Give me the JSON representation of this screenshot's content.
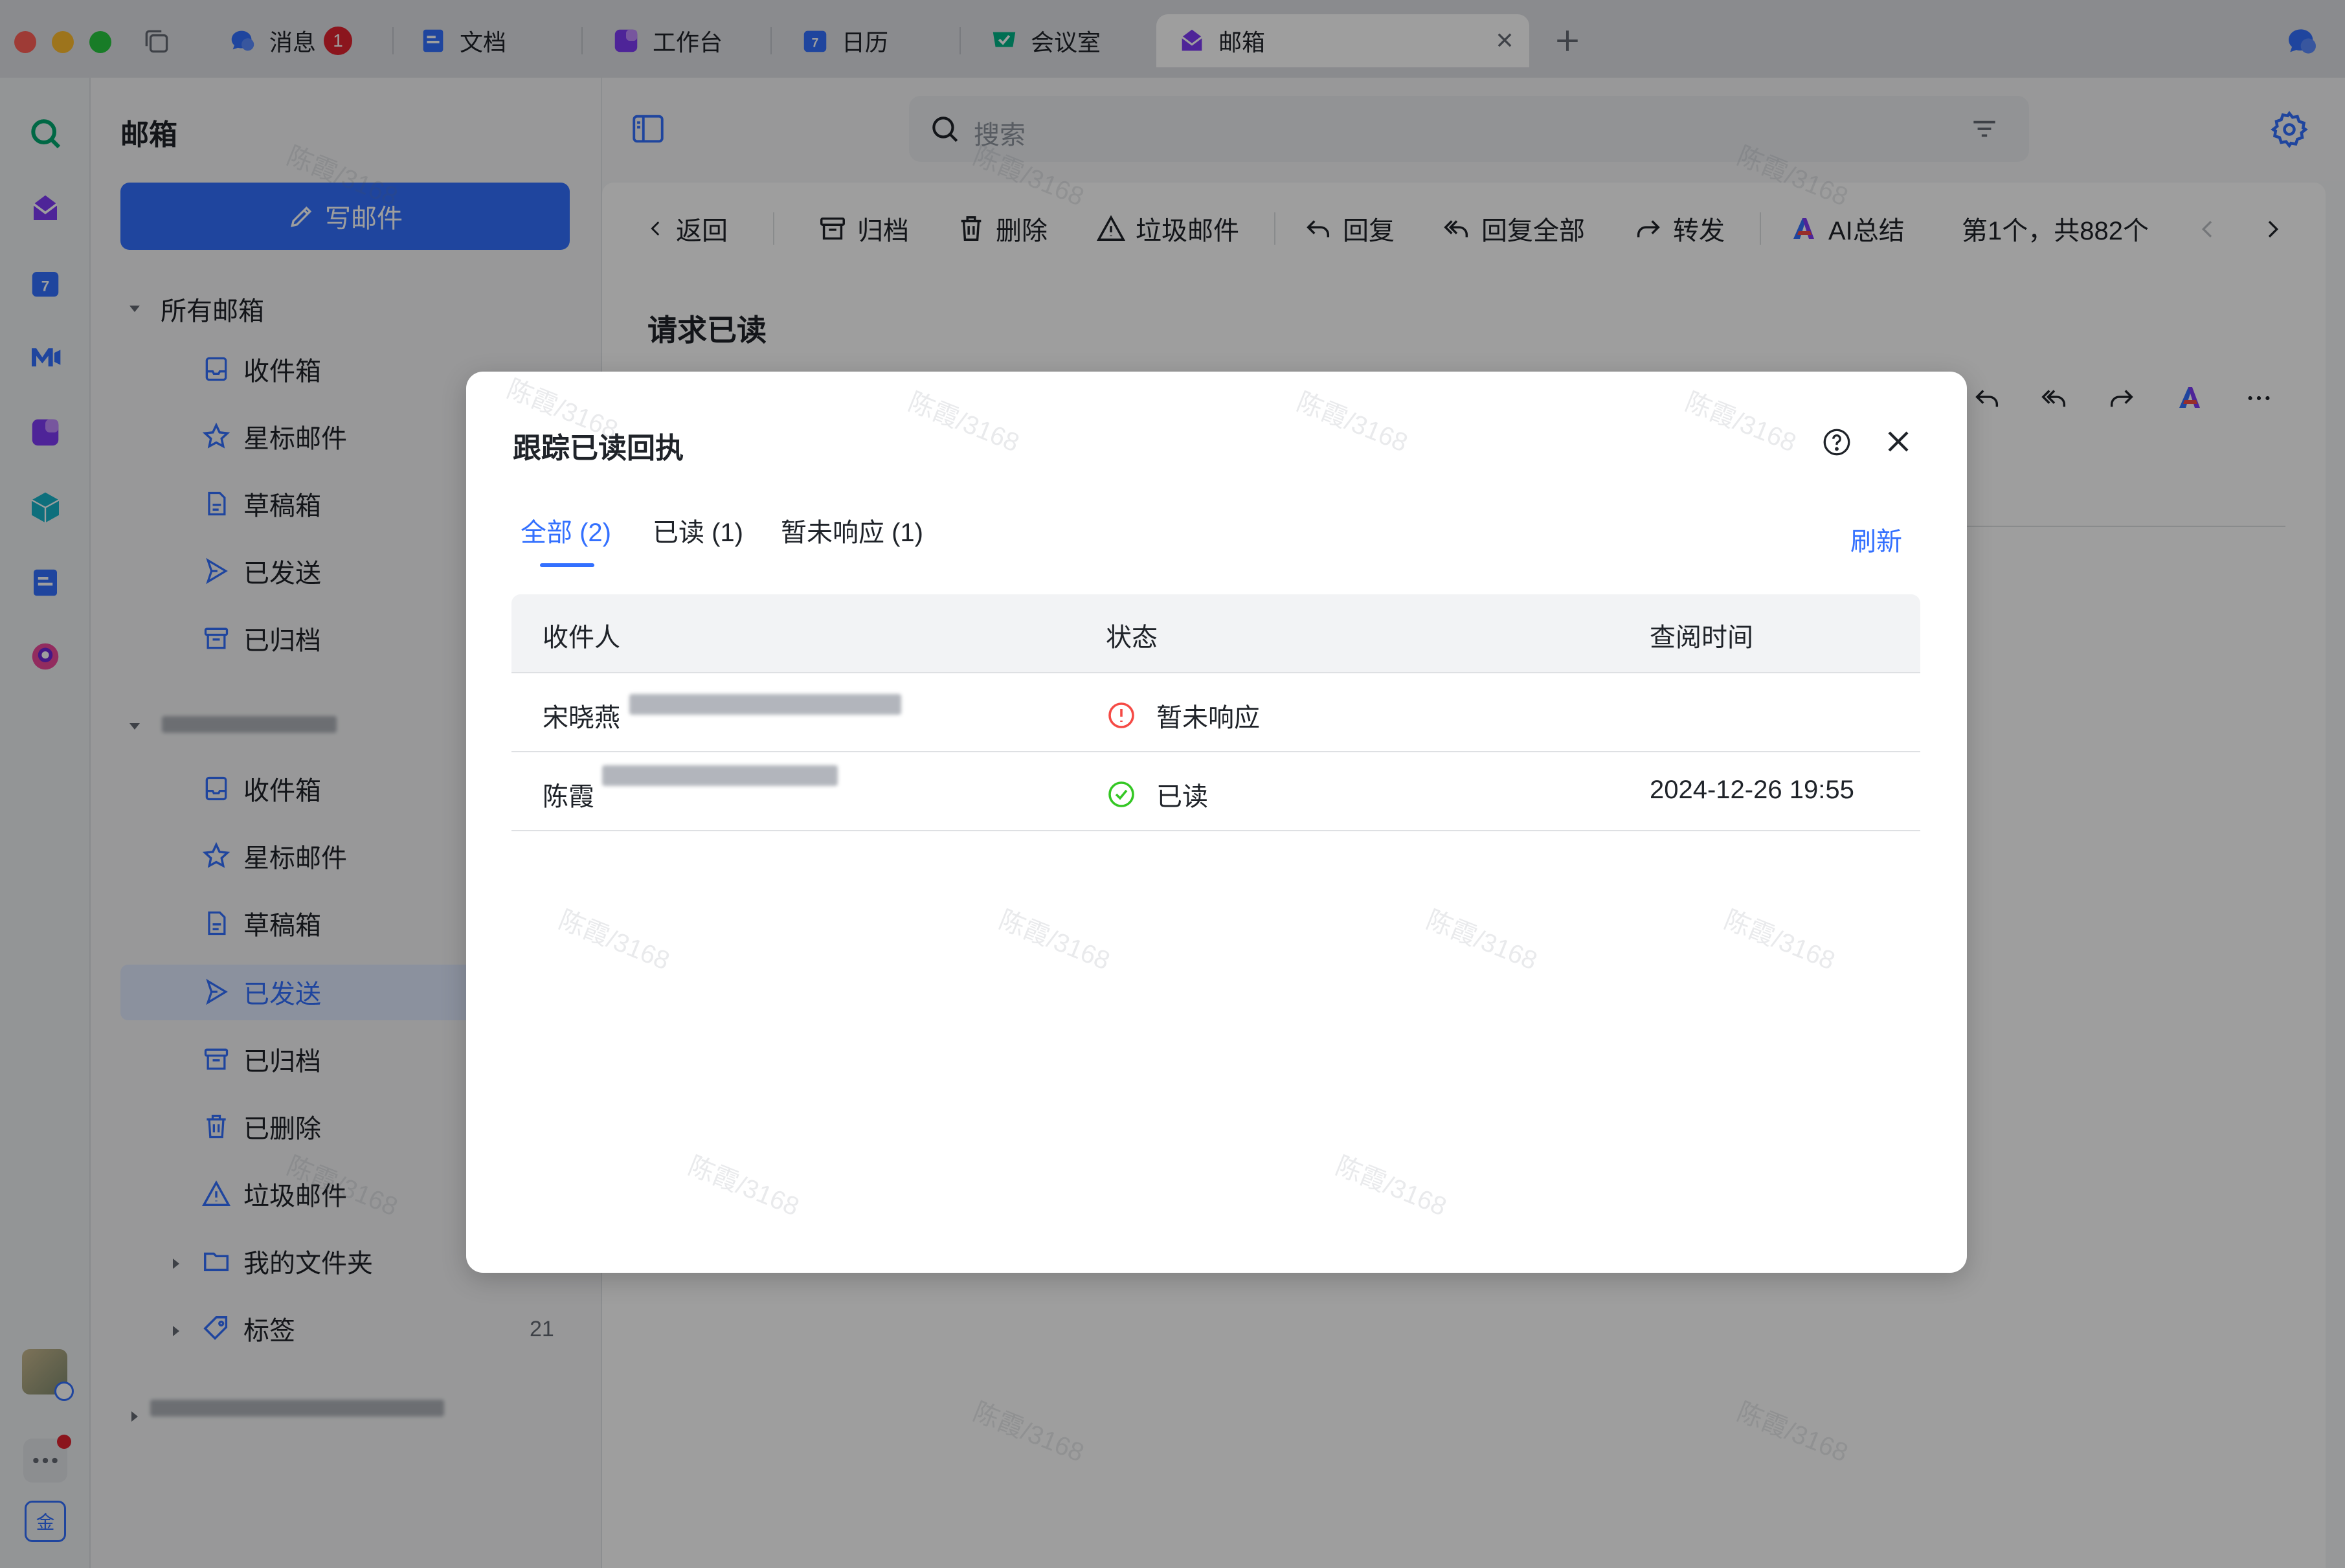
{
  "tabs": [
    {
      "label": "消息",
      "badge": "1"
    },
    {
      "label": "文档"
    },
    {
      "label": "工作台"
    },
    {
      "label": "日历"
    },
    {
      "label": "会议室"
    },
    {
      "label": "邮箱"
    }
  ],
  "sidebar": {
    "title": "邮箱",
    "compose_label": "写邮件",
    "section_all": "所有邮箱",
    "group1": [
      "收件箱",
      "星标邮件",
      "草稿箱",
      "已发送",
      "已归档"
    ],
    "group2": [
      "收件箱",
      "星标邮件",
      "草稿箱",
      "已发送",
      "已归档",
      "已删除",
      "垃圾邮件"
    ],
    "my_folders": "我的文件夹",
    "tags": "标签",
    "tags_count": "21"
  },
  "search": {
    "placeholder": "搜索"
  },
  "toolbar": {
    "back": "返回",
    "archive": "归档",
    "delete": "删除",
    "spam": "垃圾邮件",
    "reply": "回复",
    "reply_all": "回复全部",
    "forward": "转发",
    "ai_summary": "AI总结",
    "position": "第1个，共882个"
  },
  "mail": {
    "subject": "请求已读"
  },
  "modal": {
    "title": "跟踪已读回执",
    "tabs": [
      "全部 (2)",
      "已读 (1)",
      "暂未响应 (1)"
    ],
    "refresh": "刷新",
    "columns": [
      "收件人",
      "状态",
      "查阅时间"
    ],
    "rows": [
      {
        "recipient": "宋晓燕",
        "status": "暂未响应",
        "time": ""
      },
      {
        "recipient": "陈霞",
        "status": "已读",
        "time": "2024-12-26 19:55"
      }
    ]
  },
  "watermark": "陈霞/3168",
  "colors": {
    "accent": "#3370ff",
    "warning": "#f54a45",
    "success": "#34c724"
  }
}
